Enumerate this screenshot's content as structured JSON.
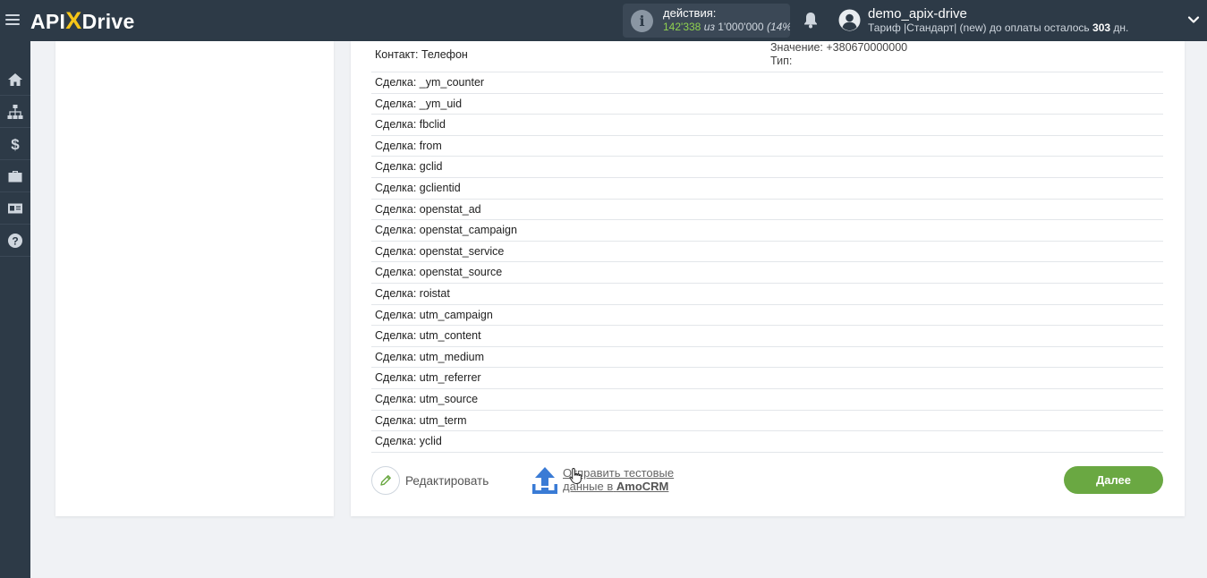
{
  "header": {
    "logo_left": "API",
    "logo_x": "X",
    "logo_right": "Drive",
    "actions": {
      "label": "действия:",
      "used": "142'338",
      "of": "из",
      "limit": "1'000'000",
      "percent": "(14%)"
    },
    "user": {
      "name": "demo_apix-drive",
      "plan_prefix": "Тариф |Стандарт| (new) до оплаты осталось",
      "days": "303",
      "days_suffix": "дн."
    }
  },
  "sidebar": {
    "items": [
      {
        "icon": "home-icon"
      },
      {
        "icon": "sitemap-icon"
      },
      {
        "icon": "dollar-icon"
      },
      {
        "icon": "briefcase-icon"
      },
      {
        "icon": "id-card-icon"
      },
      {
        "icon": "help-icon"
      }
    ]
  },
  "fields": {
    "first": {
      "label": "Контакт: Телефон",
      "value_line1": "Значение: +380670000000",
      "value_line2": "Тип:"
    },
    "rows": [
      "Сделка: _ym_counter",
      "Сделка: _ym_uid",
      "Сделка: fbclid",
      "Сделка: from",
      "Сделка: gclid",
      "Сделка: gclientid",
      "Сделка: openstat_ad",
      "Сделка: openstat_campaign",
      "Сделка: openstat_service",
      "Сделка: openstat_source",
      "Сделка: roistat",
      "Сделка: utm_campaign",
      "Сделка: utm_content",
      "Сделка: utm_medium",
      "Сделка: utm_referrer",
      "Сделка: utm_source",
      "Сделка: utm_term",
      "Сделка: yclid"
    ]
  },
  "footer": {
    "edit_label": "Редактировать",
    "send_line1": "Отправить тестовые",
    "send_line2_prefix": "данные в",
    "send_line2_brand": "AmoCRM",
    "next_label": "Далее"
  },
  "colors": {
    "topbar": "#2d3a47",
    "accent_green": "#6aa842",
    "logo_x": "#f5c518",
    "upload_blue": "#3a7bd5"
  }
}
